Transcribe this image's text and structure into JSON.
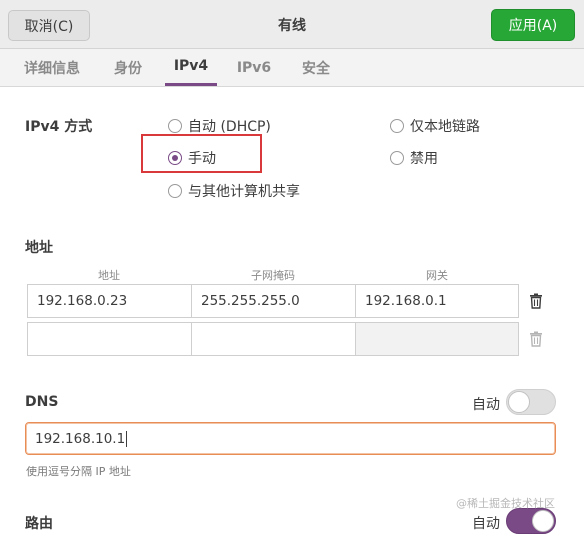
{
  "titlebar": {
    "cancel_label": "取消(C)",
    "title": "有线",
    "apply_label": "应用(A)"
  },
  "tabs": [
    {
      "label": "详细信息",
      "active": false
    },
    {
      "label": "身份",
      "active": false
    },
    {
      "label": "IPv4",
      "active": true
    },
    {
      "label": "IPv6",
      "active": false
    },
    {
      "label": "安全",
      "active": false
    }
  ],
  "ipv4_method": {
    "label": "IPv4 方式",
    "options": [
      {
        "label": "自动 (DHCP)",
        "checked": false
      },
      {
        "label": "仅本地链路",
        "checked": false
      },
      {
        "label": "手动",
        "checked": true
      },
      {
        "label": "禁用",
        "checked": false
      },
      {
        "label": "与其他计算机共享",
        "checked": false
      }
    ]
  },
  "addresses": {
    "label": "地址",
    "columns": [
      "地址",
      "子网掩码",
      "网关"
    ],
    "rows": [
      [
        "192.168.0.23",
        "255.255.255.0",
        "192.168.0.1"
      ],
      [
        "",
        "",
        ""
      ]
    ]
  },
  "dns": {
    "label": "DNS",
    "auto_label": "自动",
    "auto_enabled": false,
    "value": "192.168.10.1",
    "hint": "使用逗号分隔 IP 地址"
  },
  "routes": {
    "label": "路由",
    "auto_label": "自动",
    "auto_enabled": true
  },
  "watermark": "@稀土掘金技术社区",
  "colors": {
    "accent": "#7a4a86",
    "apply_green": "#26a736",
    "highlight_red": "#d9393b",
    "focus_orange": "#e98d57"
  }
}
